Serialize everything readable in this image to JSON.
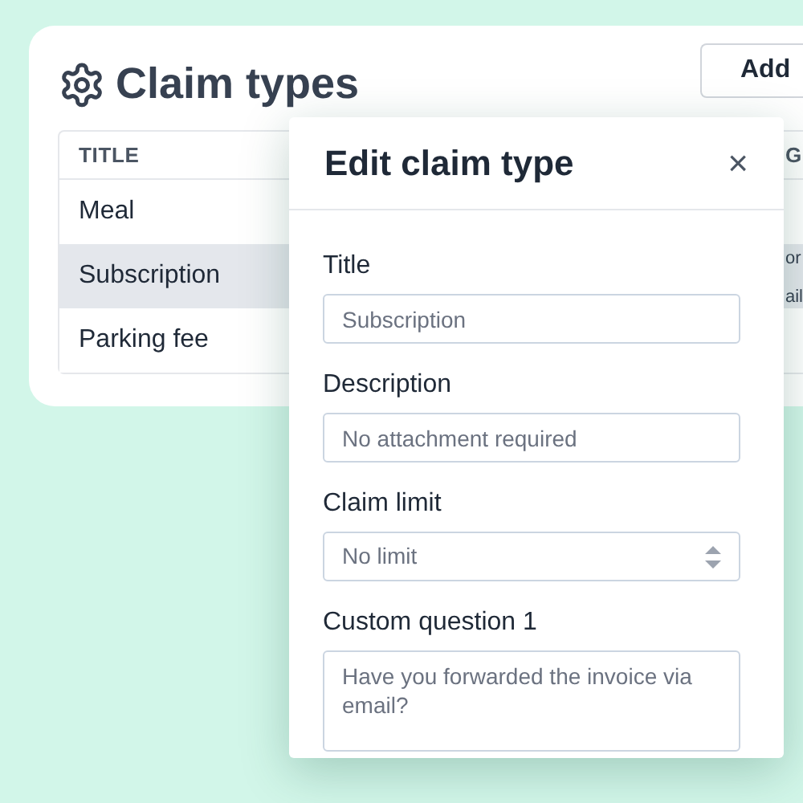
{
  "page": {
    "title": "Claim types",
    "add_button": "Add"
  },
  "table": {
    "columns": [
      "TITLE",
      "G"
    ],
    "rows": [
      {
        "cells": [
          "Meal"
        ],
        "selected": false
      },
      {
        "cells": [
          "Subscription",
          "or\nail"
        ],
        "selected": true
      },
      {
        "cells": [
          "Parking fee"
        ],
        "selected": false
      }
    ]
  },
  "dialog": {
    "title": "Edit claim type",
    "close": "×",
    "fields": [
      {
        "kind": "text",
        "label": "Title",
        "value": "Subscription"
      },
      {
        "kind": "text",
        "label": "Description",
        "value": "No attachment required"
      },
      {
        "kind": "select",
        "label": "Claim limit",
        "value": "No limit"
      },
      {
        "kind": "textarea",
        "label": "Custom question 1",
        "value": "Have you forwarded the invoice via email?"
      }
    ]
  }
}
